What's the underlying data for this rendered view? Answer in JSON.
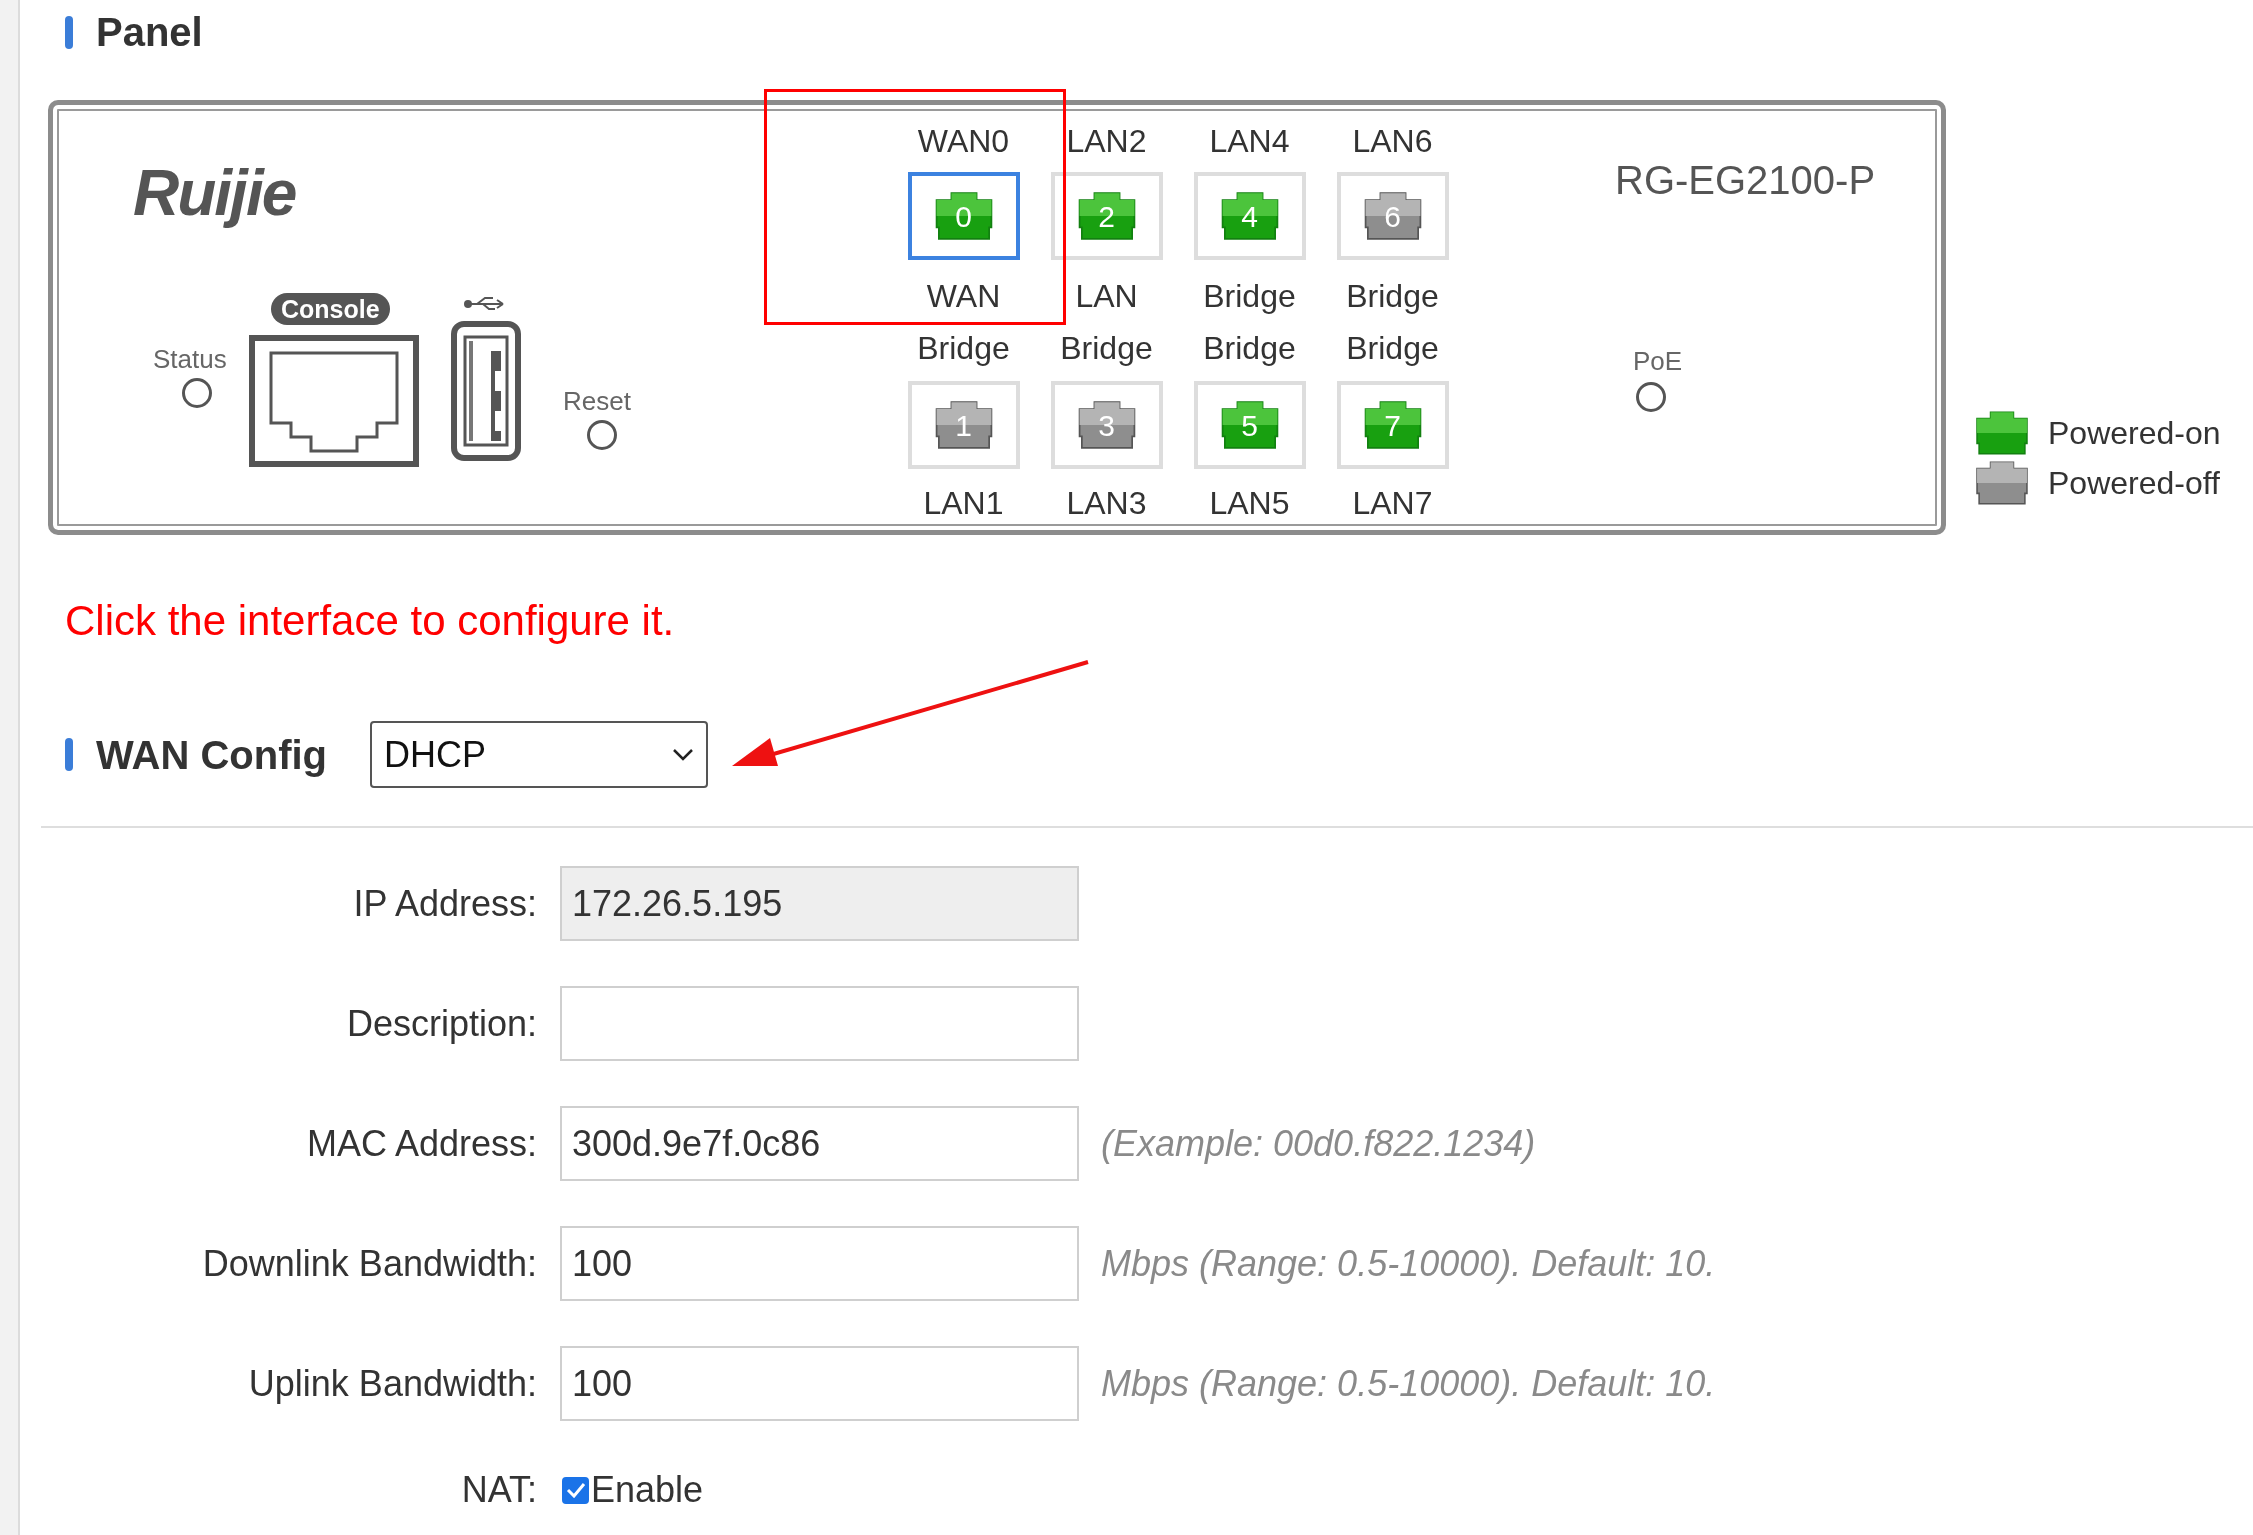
{
  "panel": {
    "title": "Panel",
    "device": {
      "logo": "Ruijie",
      "model": "RG-EG2100-P",
      "status_label": "Status",
      "console_label": "Console",
      "reset_label": "Reset",
      "poe_label": "PoE",
      "ports_top": [
        {
          "name": "WAN0",
          "number": "0",
          "role": "WAN",
          "powered": true,
          "selected": true
        },
        {
          "name": "LAN2",
          "number": "2",
          "role": "LAN",
          "powered": true,
          "selected": false
        },
        {
          "name": "LAN4",
          "number": "4",
          "role": "Bridge",
          "powered": true,
          "selected": false
        },
        {
          "name": "LAN6",
          "number": "6",
          "role": "Bridge",
          "powered": false,
          "selected": false
        }
      ],
      "ports_bottom": [
        {
          "name": "LAN1",
          "number": "1",
          "role": "Bridge",
          "powered": false,
          "selected": false
        },
        {
          "name": "LAN3",
          "number": "3",
          "role": "Bridge",
          "powered": false,
          "selected": false
        },
        {
          "name": "LAN5",
          "number": "5",
          "role": "Bridge",
          "powered": true,
          "selected": false
        },
        {
          "name": "LAN7",
          "number": "7",
          "role": "Bridge",
          "powered": true,
          "selected": false
        }
      ]
    },
    "legend": [
      {
        "label": "Powered-on",
        "powered": true
      },
      {
        "label": "Powered-off",
        "powered": false
      }
    ]
  },
  "hint": "Click the interface to configure it.",
  "wan_config": {
    "title": "WAN Config",
    "mode": "DHCP"
  },
  "form": [
    {
      "kind": "text",
      "label": "IP Address:",
      "value": "172.26.5.195",
      "disabled": true
    },
    {
      "kind": "text",
      "label": "Description:",
      "disabled": false
    },
    {
      "kind": "text",
      "label": "MAC Address:",
      "value": "300d.9e7f.0c86",
      "disabled": false,
      "note": "(Example: 00d0.f822.1234)"
    },
    {
      "kind": "text",
      "label": "Downlink Bandwidth:",
      "value": "100",
      "disabled": false,
      "note": "Mbps (Range: 0.5-10000). Default: 10."
    },
    {
      "kind": "text",
      "label": "Uplink Bandwidth:",
      "value": "100",
      "disabled": false,
      "note": "Mbps (Range: 0.5-10000). Default: 10."
    },
    {
      "kind": "checkbox",
      "label": "NAT:",
      "option": "Enable",
      "checked": true
    }
  ]
}
